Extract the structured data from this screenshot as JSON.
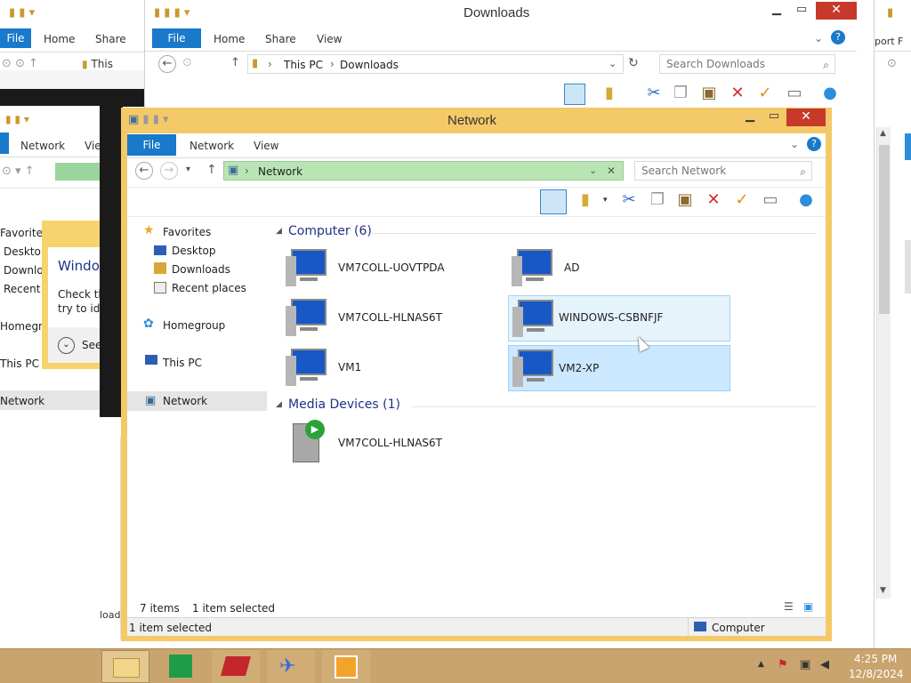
{
  "bg_left": {
    "home": "Home",
    "share": "Share",
    "file": "File",
    "addr": "This",
    "network_tab": "Network",
    "view_tab": "View",
    "nav": [
      "Favorites",
      "Desktop",
      "Downloads",
      "Recent places",
      "Homegroup",
      "This PC",
      "Network"
    ],
    "dialog_title": "Windows",
    "dialog_text_1": "Check th",
    "dialog_text_2": "try to ide",
    "see_label": "See",
    "load_label": "load"
  },
  "downloads": {
    "title": "Downloads",
    "tabs": [
      "File",
      "Home",
      "Share",
      "View"
    ],
    "breadcrumb": [
      "This PC",
      "Downloads"
    ],
    "search_placeholder": "Search Downloads"
  },
  "right_partial": {
    "label": "port F"
  },
  "network": {
    "title": "Network",
    "tabs": {
      "file": "File",
      "network": "Network",
      "view": "View"
    },
    "breadcrumb": "Network",
    "search_placeholder": "Search Network",
    "nav": {
      "favorites": "Favorites",
      "desktop": "Desktop",
      "downloads": "Downloads",
      "recent": "Recent places",
      "homegroup": "Homegroup",
      "thispc": "This PC",
      "network": "Network"
    },
    "groups": {
      "computer": "Computer (6)",
      "media": "Media Devices (1)"
    },
    "computers": [
      "VM7COLL-UOVTPDA",
      "AD",
      "VM7COLL-HLNAS6T",
      "WINDOWS-CSBNFJF",
      "VM1",
      "VM2-XP"
    ],
    "media": [
      "VM7COLL-HLNAS6T"
    ],
    "status": {
      "items": "7 items",
      "selected": "1 item selected",
      "bottom_selected": "1 item selected",
      "bottom_location": "Computer"
    }
  },
  "taskbar": {
    "time": "4:25 PM",
    "date": "12/8/2024"
  },
  "colors": {
    "accent": "#1979ca",
    "window_border": "#f0c760",
    "selection": "#cce8ff",
    "taskbar": "#c9a46e"
  }
}
